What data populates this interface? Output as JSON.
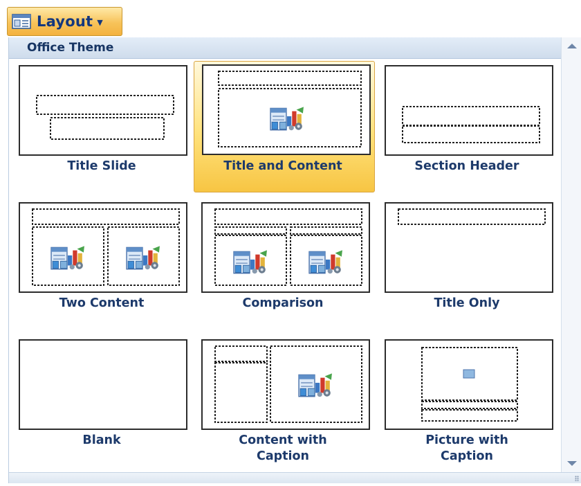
{
  "toolbar": {
    "button_label": "Layout",
    "button_icon": "layout-icon",
    "caret_icon": "caret-down-icon"
  },
  "gallery": {
    "section_title": "Office Theme",
    "colors": {
      "label": "#1d3a6b",
      "selected_start": "#fff8dc",
      "selected_end": "#f7c543",
      "header_bg": "#d6e2f0"
    },
    "layouts": [
      {
        "label": "Title Slide",
        "selected": false
      },
      {
        "label": "Title and Content",
        "selected": true
      },
      {
        "label": "Section Header",
        "selected": false
      },
      {
        "label": "Two Content",
        "selected": false
      },
      {
        "label": "Comparison",
        "selected": false
      },
      {
        "label": "Title Only",
        "selected": false
      },
      {
        "label": "Blank",
        "selected": false
      },
      {
        "label": "Content with Caption",
        "selected": false
      },
      {
        "label": "Picture with Caption",
        "selected": false
      }
    ]
  }
}
